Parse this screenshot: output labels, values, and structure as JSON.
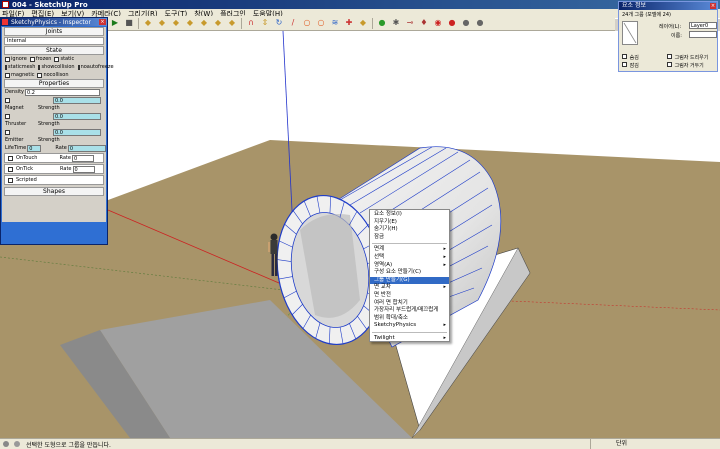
{
  "window": {
    "title": "004 - SketchUp Pro"
  },
  "menu": [
    "파일(F)",
    "편집(E)",
    "보기(V)",
    "카메라(C)",
    "그리기(R)",
    "도구(T)",
    "창(W)",
    "플러그인",
    "도움말(H)"
  ],
  "toolbar_icons": [
    "play-icon",
    "stop-icon",
    "cube-icon",
    "cube-icon",
    "cube-icon",
    "cube-icon",
    "cube-icon",
    "cube-icon",
    "cube-icon",
    "magnet-icon",
    "push-pull-icon",
    "rotate-icon",
    "line-icon",
    "circle-icon",
    "circle-icon",
    "spring-icon",
    "joint-icon",
    "cube-icon",
    "green-gem-icon",
    "gear-icon",
    "pin-icon",
    "paint-icon",
    "red-record-icon",
    "red-dot-icon",
    "sphere-icon",
    "sphere-icon"
  ],
  "physics_panel": {
    "title": "SketchyPhysics - Inspector",
    "joints_label": "Joints",
    "joints_value": "Internal",
    "state_label": "State",
    "state_row1": [
      "ignore",
      "frozen",
      "static"
    ],
    "state_row2": [
      "staticmesh",
      "showcollision",
      "noautofreeze"
    ],
    "state_row3": [
      "magnetic",
      "nocollison"
    ],
    "properties_label": "Properties",
    "density_label": "Density",
    "density_value": "0.2",
    "magnet_label": "Magnet",
    "thruster_label": "Thruster",
    "emitter_label": "Emitter",
    "strength_label": "Strength",
    "strength_value": "0.0",
    "lifetime_label": "LifeTime",
    "lifetime_value": "0",
    "rate_label": "Rate",
    "rate_value": "0",
    "ontouch_label": "OnTouch",
    "ontick_label": "OnTick",
    "scripted_label": "Scripted",
    "shapes_label": "Shapes"
  },
  "entity_panel": {
    "title": "요소 정보",
    "header": "24개 그룹 (모델에 24)",
    "layer_label": "레이어(L):",
    "layer_value": "Layer0",
    "name_label": "이름:",
    "hidden": "숨김",
    "locked": "잠김",
    "cast_shadows": "그림자 드리우기",
    "receive_shadows": "그림자 거두기"
  },
  "context_menu": {
    "group1": [
      "요소 정보(I)",
      "지우기(E)",
      "숨기기(H)",
      "잠금"
    ],
    "group2": [
      {
        "label": "면계",
        "arrow": true
      },
      {
        "label": "선택",
        "arrow": true
      },
      {
        "label": "영역(A)",
        "arrow": true
      },
      {
        "label": "구성 요소 만들기(C)",
        "arrow": false
      },
      {
        "label": "그룹 만들기(G)",
        "arrow": false,
        "highlighted": true
      },
      {
        "label": "면 교차",
        "arrow": true
      },
      {
        "label": "면 반전",
        "arrow": false
      },
      {
        "label": "여러 면 합치기",
        "arrow": false
      },
      {
        "label": "가장자리 부드럽게/매끄럽게",
        "arrow": false
      },
      {
        "label": "범위 확대/축소",
        "arrow": false
      },
      {
        "label": "SketchyPhysics",
        "arrow": true
      }
    ],
    "group3": [
      {
        "label": "Twilight",
        "arrow": true
      }
    ]
  },
  "status_bar": {
    "message": "선택한 도형으로 그룹을 만듭니다.",
    "units_label": "단위"
  },
  "colors": {
    "ground": "#a89469",
    "ramp": "#ffffff",
    "floor": "#a0a0a0",
    "selection": "#1e3cc8",
    "menu_highlight": "#316ac5"
  }
}
